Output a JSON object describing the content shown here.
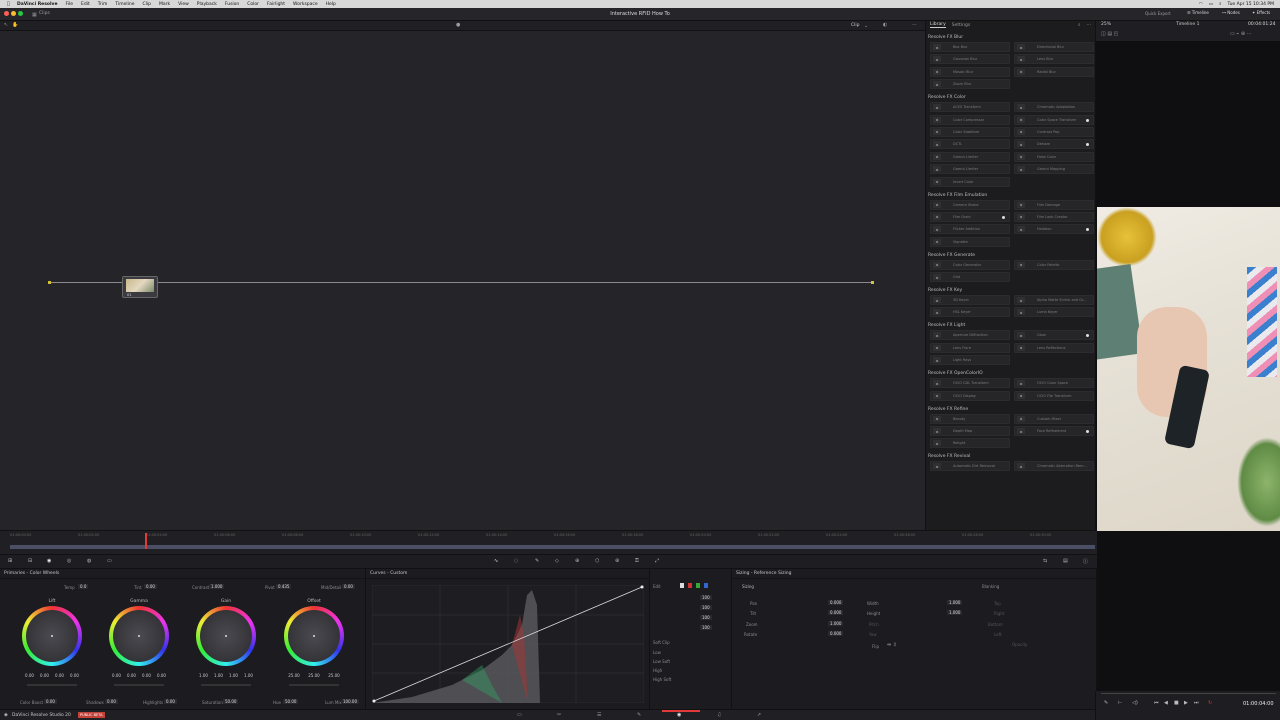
{
  "menubar": {
    "apple": "",
    "app": "DaVinci Resolve",
    "items": [
      "File",
      "Edit",
      "Trim",
      "Timeline",
      "Clip",
      "Mark",
      "View",
      "Playback",
      "Fusion",
      "Color",
      "Fairlight",
      "Workspace",
      "Help"
    ],
    "clock": "Tue Apr 15 10:34 PM"
  },
  "titlebar": {
    "breadcrumb": "Clips",
    "project_title": "Interactive RFID How To",
    "quick_export": "Quick Export",
    "timeline_btn": "Timeline",
    "nodes_btn": "Nodes",
    "effects_btn": "Effects"
  },
  "nodegraph": {
    "clip_mode": "Clip",
    "node_label": "01"
  },
  "fxlib": {
    "tab_library": "Library",
    "tab_settings": "Settings",
    "categories": [
      {
        "name": "Resolve FX Blur",
        "items": [
          {
            "label": "Box Blur"
          },
          {
            "label": "Directional Blur"
          },
          {
            "label": "Gaussian Blur"
          },
          {
            "label": "Lens Blur"
          },
          {
            "label": "Mosaic Blur"
          },
          {
            "label": "Radial Blur"
          },
          {
            "label": "Zoom Blur"
          }
        ]
      },
      {
        "name": "Resolve FX Color",
        "items": [
          {
            "label": "ACES Transform"
          },
          {
            "label": "Chromatic Adaptation"
          },
          {
            "label": "Color Compressor"
          },
          {
            "label": "Color Space Transform",
            "dot": true
          },
          {
            "label": "Color Stabilizer"
          },
          {
            "label": "Contrast Pop"
          },
          {
            "label": "DCTL"
          },
          {
            "label": "Dehaze",
            "dot": true
          },
          {
            "label": "Gamut Limiter"
          },
          {
            "label": "False Color"
          },
          {
            "label": "Gamut Limiter"
          },
          {
            "label": "Gamut Mapping"
          },
          {
            "label": "Invert Color"
          }
        ]
      },
      {
        "name": "Resolve FX Film Emulation",
        "items": [
          {
            "label": "Camera Shake"
          },
          {
            "label": "Film Damage"
          },
          {
            "label": "Film Grain",
            "dot": true
          },
          {
            "label": "Film Look Creator"
          },
          {
            "label": "Flicker Addition"
          },
          {
            "label": "Halation",
            "dot": true
          },
          {
            "label": "Vignette"
          }
        ]
      },
      {
        "name": "Resolve FX Generate",
        "items": [
          {
            "label": "Color Generator"
          },
          {
            "label": "Color Palette"
          },
          {
            "label": "Grid"
          }
        ]
      },
      {
        "name": "Resolve FX Key",
        "items": [
          {
            "label": "3D Keyer"
          },
          {
            "label": "Alpha Matte Shrink and Gr..."
          },
          {
            "label": "HSL Keyer"
          },
          {
            "label": "Luma Keyer"
          }
        ]
      },
      {
        "name": "Resolve FX Light",
        "items": [
          {
            "label": "Aperture Diffraction"
          },
          {
            "label": "Glow",
            "dot": true
          },
          {
            "label": "Lens Flare"
          },
          {
            "label": "Lens Reflections"
          },
          {
            "label": "Light Rays"
          }
        ]
      },
      {
        "name": "Resolve FX OpenColorIO",
        "items": [
          {
            "label": "OCIO CDL Transform"
          },
          {
            "label": "OCIO Color Space"
          },
          {
            "label": "OCIO Display"
          },
          {
            "label": "OCIO File Transform"
          }
        ]
      },
      {
        "name": "Resolve FX Refine",
        "items": [
          {
            "label": "Beauty"
          },
          {
            "label": "Custom Mixer"
          },
          {
            "label": "Depth Map"
          },
          {
            "label": "Face Refinement",
            "dot": true
          },
          {
            "label": "Relight"
          }
        ]
      },
      {
        "name": "Resolve FX Revival",
        "items": [
          {
            "label": "Automatic Dirt Removal"
          },
          {
            "label": "Chromatic Aberration Rem..."
          }
        ]
      }
    ]
  },
  "viewer": {
    "zoom": "25%",
    "timeline_name": "Timeline 1",
    "timecode": "00:04:01:24",
    "playhead_timecode": "01:00:04:00"
  },
  "timeline": {
    "ticks": [
      "01:00:00:00",
      "01:00:02:00",
      "01:00:04:00",
      "01:00:06:00",
      "01:00:08:00",
      "01:00:10:00",
      "01:00:12:00",
      "01:00:14:00",
      "01:00:16:00",
      "01:00:18:00",
      "01:00:20:00",
      "01:00:22:00",
      "01:00:24:00",
      "01:00:26:00",
      "01:00:28:00",
      "01:00:30:00"
    ]
  },
  "primaries": {
    "title": "Primaries - Color Wheels",
    "temp_label": "Temp",
    "temp": "0.0",
    "tint_label": "Tint",
    "tint": "0.00",
    "contrast_label": "Contrast",
    "contrast": "1.000",
    "pivot_label": "Pivot",
    "pivot": "0.435",
    "middetail_label": "Mid/Detail",
    "middetail": "0.00",
    "wheels": [
      {
        "name": "Lift",
        "vals": [
          "0.00",
          "0.00",
          "0.00",
          "0.00"
        ]
      },
      {
        "name": "Gamma",
        "vals": [
          "0.00",
          "0.00",
          "0.00",
          "0.00"
        ]
      },
      {
        "name": "Gain",
        "vals": [
          "1.00",
          "1.00",
          "1.00",
          "1.00"
        ]
      },
      {
        "name": "Offset",
        "vals": [
          "25.00",
          "25.00",
          "25.00"
        ]
      }
    ],
    "colorboost_label": "Color Boost",
    "colorboost": "0.00",
    "shadows_label": "Shadows",
    "shadows": "0.00",
    "highlights_label": "Highlights",
    "highlights": "0.00",
    "saturation_label": "Saturation",
    "saturation": "50.00",
    "hue_label": "Hue",
    "hue": "50.00",
    "lummix_label": "Lum Mix",
    "lummix": "100.00"
  },
  "curves": {
    "title": "Curves - Custom"
  },
  "curveside": {
    "edit_label": "Edit",
    "values": [
      "100",
      "100",
      "100",
      "100"
    ],
    "softclip_label": "Soft Clip",
    "sc_low": "Low",
    "sc_lowsoft": "Low Soft",
    "sc_high": "High",
    "sc_highsoft": "High Soft"
  },
  "sizing": {
    "title": "Sizing - Reference Sizing",
    "section": "Sizing",
    "pan_label": "Pan",
    "pan": "0.000",
    "tilt_label": "Tilt",
    "tilt": "0.000",
    "zoom_label": "Zoom",
    "zoom": "1.000",
    "rotate_label": "Rotate",
    "rotate": "0.000",
    "width_label": "Width",
    "width": "1.000",
    "height_label": "Height",
    "height": "1.000",
    "pitch_label": "Pitch",
    "yaw_label": "Yaw",
    "flip_label": "Flip",
    "blanking": "Blanking",
    "blank_top": "Top",
    "blank_right": "Right",
    "blank_bottom": "Bottom",
    "blank_left": "Left",
    "blank_opacity": "Opacity"
  },
  "statusbar": {
    "app": "DaVinci Resolve Studio 20",
    "badge": "PUBLIC BETA"
  },
  "colors": {
    "accent": "#e23a3a",
    "badge": "#c2423a"
  }
}
